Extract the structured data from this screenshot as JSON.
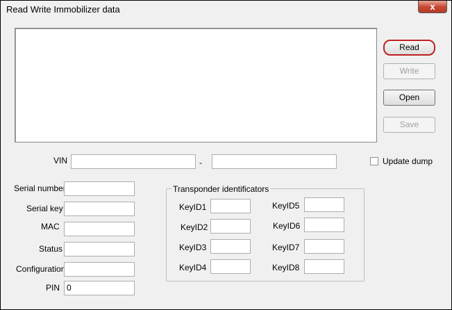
{
  "window": {
    "title": "Read Write Immobilizer data",
    "close_glyph": "x"
  },
  "buttons": {
    "read": "Read",
    "write": "Write",
    "open": "Open",
    "save": "Save"
  },
  "vin": {
    "label": "VIN",
    "separator": "-",
    "value1": "",
    "value2": ""
  },
  "update_dump": {
    "label": "Update dump",
    "checked": false
  },
  "info": {
    "serial_number": {
      "label": "Serial number",
      "value": ""
    },
    "serial_key": {
      "label": "Serial key",
      "value": ""
    },
    "mac": {
      "label": "MAC",
      "value": ""
    },
    "status": {
      "label": "Status",
      "value": ""
    },
    "configuration": {
      "label": "Configuration",
      "value": ""
    },
    "pin": {
      "label": "PIN",
      "value": "0"
    }
  },
  "transponder": {
    "title": "Transponder identificators",
    "keys": [
      {
        "label": "KeyID1",
        "value": ""
      },
      {
        "label": "KeyID2",
        "value": ""
      },
      {
        "label": "KeyID3",
        "value": ""
      },
      {
        "label": "KeyID4",
        "value": ""
      },
      {
        "label": "KeyID5",
        "value": ""
      },
      {
        "label": "KeyID6",
        "value": ""
      },
      {
        "label": "KeyID7",
        "value": ""
      },
      {
        "label": "KeyID8",
        "value": ""
      }
    ]
  },
  "colors": {
    "close_button": "#c7462f",
    "default_button_border": "#c02020"
  }
}
